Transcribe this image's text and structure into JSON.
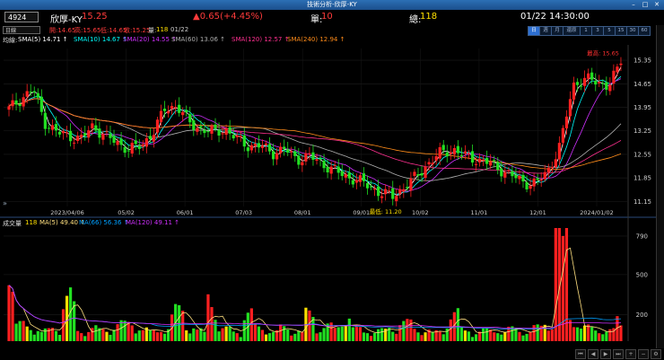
{
  "window": {
    "title": "技術分析-欣厚-KY"
  },
  "header": {
    "code": "4924",
    "name": "欣厚-KY",
    "price": "15.25",
    "change": "▲0.65(+4.45%)",
    "vol_label": "單:",
    "vol_value": "10",
    "total_vol_label": "總:",
    "total_vol_value": "118",
    "datetime": "01/22 14:30:00"
  },
  "quote_row": {
    "period": "日線",
    "open": "開:14.65",
    "high": "高:15.65",
    "low": "低:14.65",
    "close": "收:15.25",
    "qty": "量:",
    "qty_value": "118",
    "date": "01/22"
  },
  "timeframes": [
    "日",
    "週",
    "月",
    "還原",
    "1",
    "3",
    "5",
    "15",
    "30",
    "60"
  ],
  "ma_legend": {
    "label": "均線:",
    "sma5": "SMA(5) 14.71 ↑",
    "sma10": "SMA(10) 14.67 ↑",
    "sma20": "SMA(20) 14.55 ↑",
    "sma60": "SMA(60) 13.06 ↑",
    "sma120": "SMA(120) 12.57 ↑",
    "sma240": "SMA(240) 12.94 ↑"
  },
  "annotations": {
    "high_label": "最高: 15.65",
    "low_label": "最低: 11.20"
  },
  "vol_legend": {
    "label": "成交量",
    "value": "118",
    "ma5": "MA(5) 49.40 ↑",
    "ma66": "MA(66) 56.36 ↑",
    "ma120": "MA(120) 49.11 ↑"
  },
  "colors": {
    "up": "#ff2020",
    "down": "#22e022",
    "sma5": "#ffffff",
    "sma10": "#00ffff",
    "sma20": "#d030ff",
    "sma60": "#b0b0b0",
    "sma120": "#ff3090",
    "sma240": "#ff8c1a",
    "vol_ma5": "#ffe080",
    "vol_ma66": "#00a0ff",
    "vol_ma120": "#d030ff"
  },
  "chart_data": {
    "type": "candlestick",
    "price_axis_ticks": [
      "15.35",
      "14.65",
      "13.95",
      "13.25",
      "12.55",
      "11.85",
      "11.15"
    ],
    "volume_axis_ticks": [
      "790",
      "500",
      "200"
    ],
    "date_axis_labels": [
      "2023/04/06",
      "05/02",
      "06/01",
      "07/03",
      "08/01",
      "09/01",
      "10/02",
      "11/01",
      "12/01",
      "2024/01/02"
    ],
    "ylim": [
      11.0,
      15.7
    ],
    "volume_ylim": [
      0,
      850
    ],
    "closes_sample": [
      13.9,
      14.2,
      14.5,
      13.5,
      13.2,
      13.1,
      13.0,
      13.4,
      13.1,
      12.9,
      12.7,
      12.8,
      13.2,
      13.9,
      14.0,
      13.5,
      13.3,
      13.2,
      13.3,
      13.0,
      12.8,
      12.8,
      12.6,
      12.7,
      12.4,
      12.5,
      12.3,
      12.1,
      11.9,
      11.8,
      11.6,
      11.4,
      11.3,
      11.6,
      11.9,
      12.3,
      12.6,
      12.7,
      12.5,
      12.4,
      12.3,
      12.1,
      11.9,
      11.7,
      11.7,
      12.1,
      12.9,
      14.6,
      14.8,
      14.7,
      14.6,
      15.25
    ],
    "volume_sample": [
      420,
      110,
      90,
      70,
      80,
      300,
      60,
      90,
      70,
      120,
      110,
      80,
      60,
      90,
      200,
      100,
      70,
      300,
      80,
      60,
      180,
      90,
      60,
      90,
      70,
      180,
      90,
      100,
      160,
      80,
      60,
      70,
      90,
      120,
      80,
      70,
      60,
      180,
      80,
      60,
      70,
      60,
      80,
      70,
      90,
      120,
      790,
      150,
      90,
      80,
      70,
      140
    ]
  }
}
